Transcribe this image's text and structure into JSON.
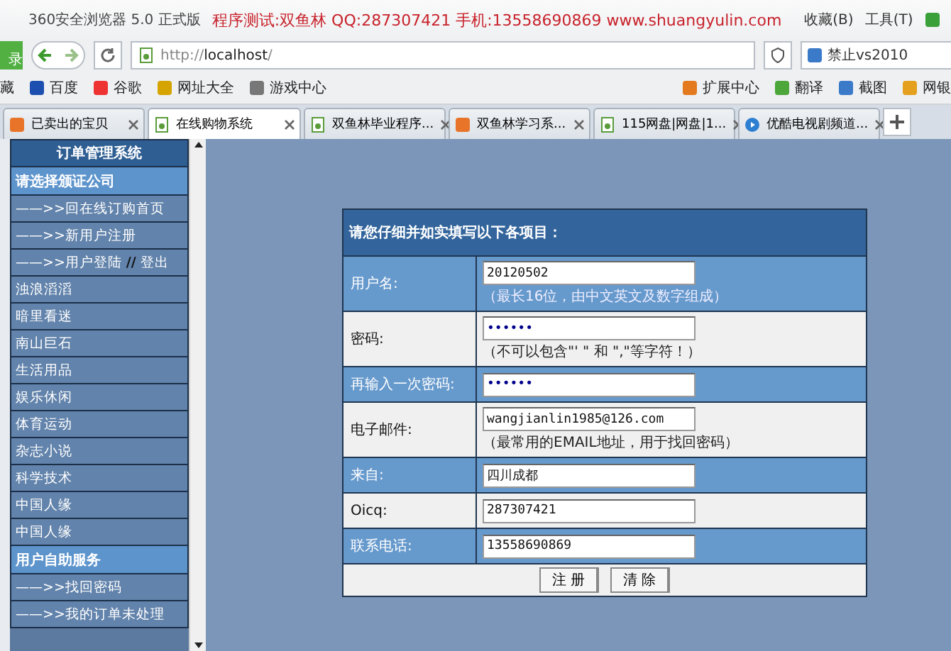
{
  "window": {
    "title": "360安全浏览器 5.0 正式版",
    "banner": "程序测试:双鱼林 QQ:287307421 手机:13558690869 www.shuangyulin.com",
    "menus": [
      "收藏(B)",
      "工具(T)"
    ]
  },
  "login_button": "录",
  "address_bar": {
    "scheme": "http://",
    "host": "localhost",
    "path": "/"
  },
  "search_box": {
    "value": "禁止vs2010"
  },
  "bookmarks": {
    "left": [
      "藏",
      "百度",
      "谷歌",
      "网址大全",
      "游戏中心"
    ],
    "right": [
      "扩展中心",
      "翻译",
      "截图",
      "网银"
    ]
  },
  "tabs": [
    {
      "label": "已卖出的宝贝",
      "kind": "shop",
      "selected": false
    },
    {
      "label": "在线购物系统",
      "kind": "page",
      "selected": true
    },
    {
      "label": "双鱼林毕业程序...",
      "kind": "page",
      "selected": false
    },
    {
      "label": "双鱼林学习系...",
      "kind": "shop",
      "selected": false
    },
    {
      "label": "115网盘|网盘|1...",
      "kind": "page",
      "selected": false
    },
    {
      "label": "优酷电视剧频道...",
      "kind": "video",
      "selected": false
    }
  ],
  "sidebar": {
    "title": "订单管理系统",
    "items": [
      {
        "kind": "header",
        "label": "请选择颁证公司"
      },
      {
        "kind": "link",
        "label": "——>>回在线订购首页"
      },
      {
        "kind": "link",
        "label": "——>>新用户注册"
      },
      {
        "kind": "link",
        "label": "——>>用户登陆",
        "separator": "//",
        "extra": "登出"
      },
      {
        "kind": "link",
        "label": "浊浪滔滔"
      },
      {
        "kind": "link",
        "label": "暗里看迷"
      },
      {
        "kind": "link",
        "label": "南山巨石"
      },
      {
        "kind": "link",
        "label": "生活用品"
      },
      {
        "kind": "link",
        "label": "娱乐休闲"
      },
      {
        "kind": "link",
        "label": "体育运动"
      },
      {
        "kind": "link",
        "label": "杂志小说"
      },
      {
        "kind": "link",
        "label": "科学技术"
      },
      {
        "kind": "link",
        "label": "中国人缘"
      },
      {
        "kind": "link",
        "label": "中国人缘"
      },
      {
        "kind": "header",
        "label": "用户自助服务"
      },
      {
        "kind": "link",
        "label": "——>>找回密码"
      },
      {
        "kind": "link",
        "label": "——>>我的订单未处理"
      }
    ]
  },
  "form": {
    "title": "请您仔细并如实填写以下各项目：",
    "rows": [
      {
        "label": "用户名:",
        "value": "20120502",
        "hint": "（最长16位，由中文英文及数字组成）"
      },
      {
        "label": "密码:",
        "value": "••••••",
        "hint": "（不可以包含\"'  \" 和 \",\"等字符！）"
      },
      {
        "label": "再输入一次密码:",
        "value": "••••••"
      },
      {
        "label": "电子邮件:",
        "value": "wangjianlin1985@126.com",
        "hint": "（最常用的EMAIL地址，用于找回密码）"
      },
      {
        "label": "来自:",
        "value": "四川成都"
      },
      {
        "label": "Oicq:",
        "value": "287307421"
      },
      {
        "label": "联系电话:",
        "value": "13558690869"
      }
    ],
    "buttons": [
      "注 册",
      "清 除"
    ]
  }
}
